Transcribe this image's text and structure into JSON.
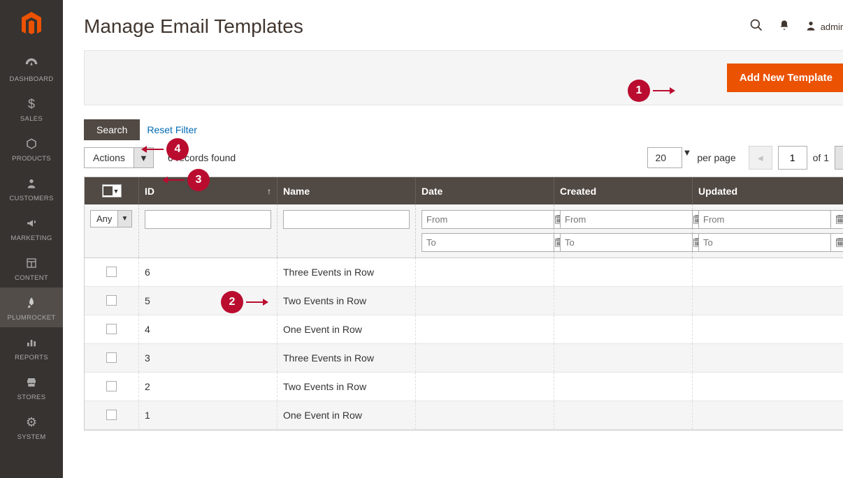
{
  "sidebar": {
    "items": [
      {
        "label": "DASHBOARD",
        "icon": "dashboard"
      },
      {
        "label": "SALES",
        "icon": "dollar"
      },
      {
        "label": "PRODUCTS",
        "icon": "box"
      },
      {
        "label": "CUSTOMERS",
        "icon": "person"
      },
      {
        "label": "MARKETING",
        "icon": "megaphone"
      },
      {
        "label": "CONTENT",
        "icon": "layout"
      },
      {
        "label": "PLUMROCKET",
        "icon": "rocket"
      },
      {
        "label": "REPORTS",
        "icon": "chart"
      },
      {
        "label": "STORES",
        "icon": "storefront"
      },
      {
        "label": "SYSTEM",
        "icon": "gear"
      }
    ]
  },
  "header": {
    "title": "Manage Email Templates",
    "user": "admin"
  },
  "toolbar": {
    "add_button": "Add New Template"
  },
  "search": {
    "button": "Search",
    "reset": "Reset Filter"
  },
  "actions": {
    "label": "Actions",
    "records_text": "6 records found"
  },
  "pagination": {
    "page_size": "20",
    "per_page_label": "per page",
    "page": "1",
    "of_label": "of 1"
  },
  "table": {
    "columns": {
      "id": "ID",
      "name": "Name",
      "date": "Date",
      "created": "Created",
      "updated": "Updated"
    },
    "filter_any": "Any",
    "filter_from": "From",
    "filter_to": "To",
    "rows": [
      {
        "id": "6",
        "name": "Three Events in Row"
      },
      {
        "id": "5",
        "name": "Two Events in Row"
      },
      {
        "id": "4",
        "name": "One Event in Row"
      },
      {
        "id": "3",
        "name": "Three Events in Row"
      },
      {
        "id": "2",
        "name": "Two Events in Row"
      },
      {
        "id": "1",
        "name": "One Event in Row"
      }
    ]
  },
  "annotations": {
    "1": "1",
    "2": "2",
    "3": "3",
    "4": "4"
  }
}
